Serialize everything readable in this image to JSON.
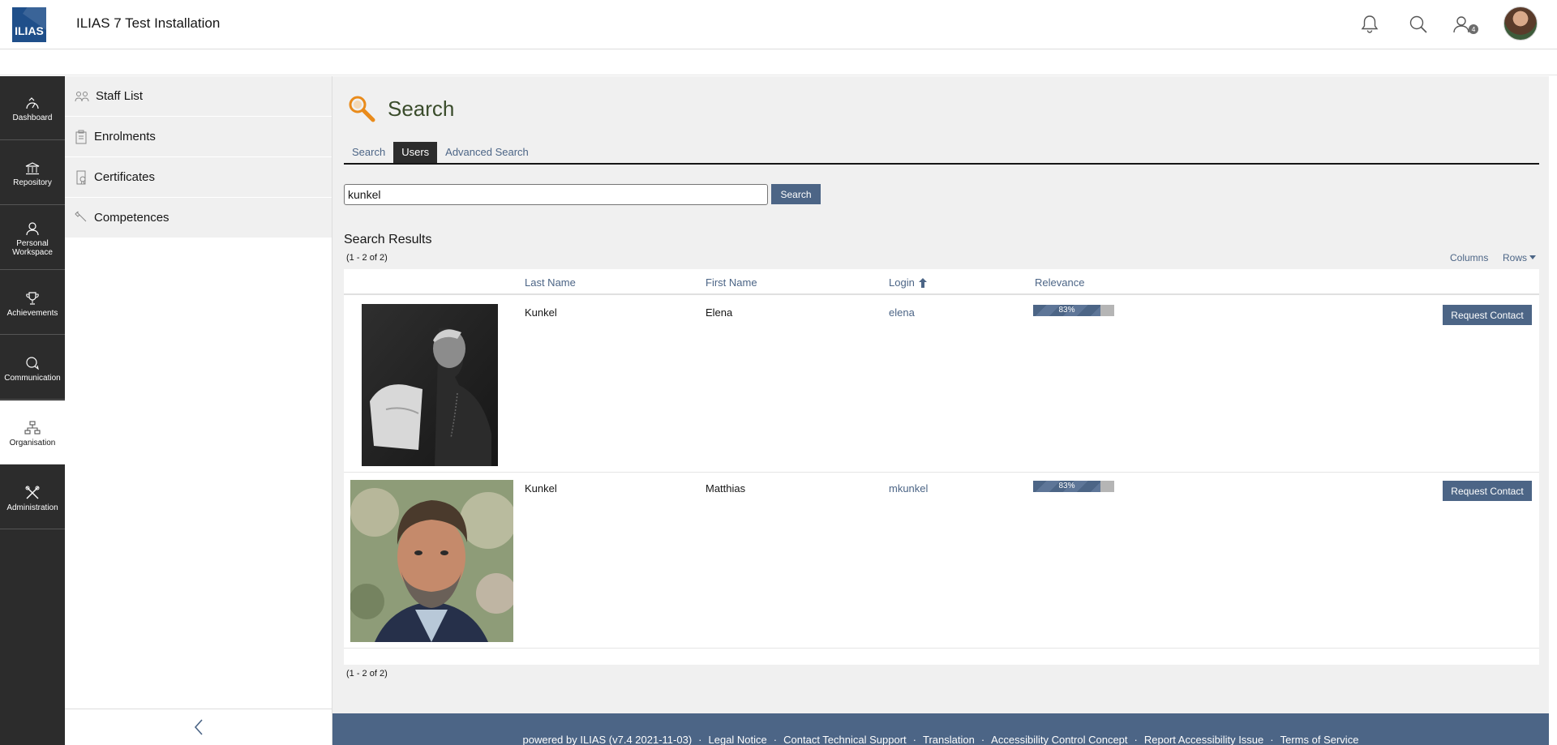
{
  "header": {
    "logo_text": "ILIAS",
    "title": "ILIAS 7 Test Installation",
    "icons": [
      "bell-icon",
      "search-icon",
      "contacts-icon",
      "avatar"
    ],
    "contacts_badge": "4"
  },
  "mainbar": {
    "items": [
      {
        "label": "Dashboard",
        "icon": "dashboard-icon"
      },
      {
        "label": "Repository",
        "icon": "repository-icon"
      },
      {
        "label": "Personal Workspace",
        "icon": "person-icon"
      },
      {
        "label": "Achievements",
        "icon": "trophy-icon"
      },
      {
        "label": "Communication",
        "icon": "chat-icon"
      },
      {
        "label": "Organisation",
        "icon": "org-chart-icon",
        "active": true
      },
      {
        "label": "Administration",
        "icon": "tools-icon"
      }
    ]
  },
  "slate": {
    "items": [
      {
        "label": "Staff List",
        "icon": "staff-icon"
      },
      {
        "label": "Enrolments",
        "icon": "clipboard-icon"
      },
      {
        "label": "Certificates",
        "icon": "certificate-icon"
      },
      {
        "label": "Competences",
        "icon": "competence-icon"
      }
    ]
  },
  "page": {
    "title": "Search",
    "tabs": [
      {
        "label": "Search"
      },
      {
        "label": "Users",
        "active": true
      },
      {
        "label": "Advanced Search"
      }
    ],
    "search_value": "kunkel",
    "search_button": "Search",
    "results_title": "Search Results",
    "count_top": "(1 - 2 of 2)",
    "count_bottom": "(1 - 2 of 2)",
    "columns_label": "Columns",
    "rows_label": "Rows",
    "table": {
      "headers": {
        "last_name": "Last Name",
        "first_name": "First Name",
        "login": "Login",
        "relevance": "Relevance"
      },
      "rows": [
        {
          "last_name": "Kunkel",
          "first_name": "Elena",
          "login": "elena",
          "relevance_label": "83%",
          "relevance": 0.83,
          "action": "Request Contact"
        },
        {
          "last_name": "Kunkel",
          "first_name": "Matthias",
          "login": "mkunkel",
          "relevance_label": "83%",
          "relevance": 0.83,
          "action": "Request Contact"
        }
      ]
    }
  },
  "footer": {
    "links": [
      "powered by ILIAS (v7.4 2021-11-03)",
      "Legal Notice",
      "Contact Technical Support",
      "Translation",
      "Accessibility Control Concept",
      "Report Accessibility Issue",
      "Terms of Service"
    ]
  },
  "colors": {
    "accent": "#4c6586",
    "mainbar": "#2c2c2c",
    "title": "#3a4c2b"
  }
}
